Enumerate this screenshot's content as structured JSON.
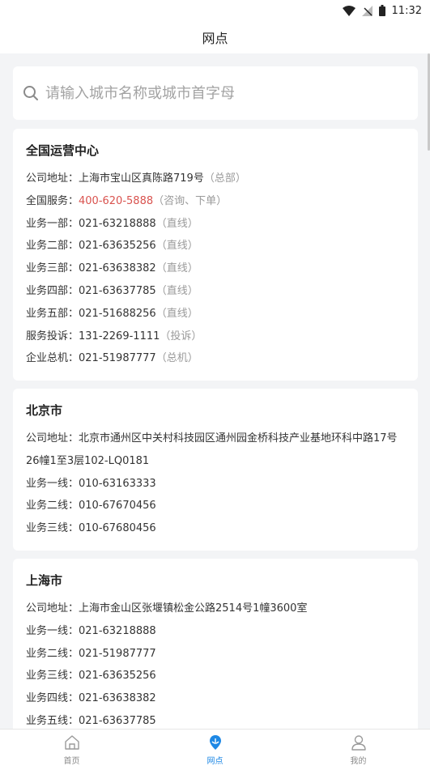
{
  "status_bar": {
    "time": "11:32"
  },
  "nav": {
    "title": "网点"
  },
  "search": {
    "placeholder": "请输入城市名称或城市首字母"
  },
  "cards": [
    {
      "title": "全国运营中心",
      "rows": [
        {
          "label": "公司地址：",
          "value": "上海市宝山区真陈路719号",
          "note": "（总部）"
        },
        {
          "label": "全国服务：",
          "value": "400-620-5888",
          "note": "（咨询、下单）",
          "highlight": true
        },
        {
          "label": "业务一部：",
          "value": "021-63218888",
          "note": "（直线）"
        },
        {
          "label": "业务二部：",
          "value": "021-63635256",
          "note": "（直线）"
        },
        {
          "label": "业务三部：",
          "value": "021-63638382",
          "note": "（直线）"
        },
        {
          "label": "业务四部：",
          "value": "021-63637785",
          "note": "（直线）"
        },
        {
          "label": "业务五部：",
          "value": "021-51688256",
          "note": "（直线）"
        },
        {
          "label": "服务投诉：",
          "value": "131-2269-1111",
          "note": "（投诉）"
        },
        {
          "label": "企业总机：",
          "value": "021-51987777",
          "note": "（总机）"
        }
      ]
    },
    {
      "title": "北京市",
      "rows": [
        {
          "label": "公司地址：",
          "value": "北京市通州区中关村科技园区通州园金桥科技产业基地环科中路17号26幢1至3层102-LQ0181",
          "note": ""
        },
        {
          "label": "业务一线：",
          "value": "010-63163333",
          "note": ""
        },
        {
          "label": "业务二线：",
          "value": "010-67670456",
          "note": ""
        },
        {
          "label": "业务三线：",
          "value": "010-67680456",
          "note": ""
        }
      ]
    },
    {
      "title": "上海市",
      "rows": [
        {
          "label": "公司地址：",
          "value": "上海市金山区张堰镇松金公路2514号1幢3600室",
          "note": ""
        },
        {
          "label": "业务一线：",
          "value": "021-63218888",
          "note": ""
        },
        {
          "label": "业务二线：",
          "value": "021-51987777",
          "note": ""
        },
        {
          "label": "业务三线：",
          "value": "021-63635256",
          "note": ""
        },
        {
          "label": "业务四线：",
          "value": "021-63638382",
          "note": ""
        },
        {
          "label": "业务五线：",
          "value": "021-63637785",
          "note": ""
        }
      ]
    }
  ],
  "tabs": [
    {
      "label": "首页",
      "icon": "home-icon",
      "active": false
    },
    {
      "label": "网点",
      "icon": "location-icon",
      "active": true
    },
    {
      "label": "我的",
      "icon": "user-icon",
      "active": false
    }
  ],
  "colors": {
    "accent": "#1e88e5",
    "hotline": "#d9534f",
    "note": "#9a9a9a"
  }
}
